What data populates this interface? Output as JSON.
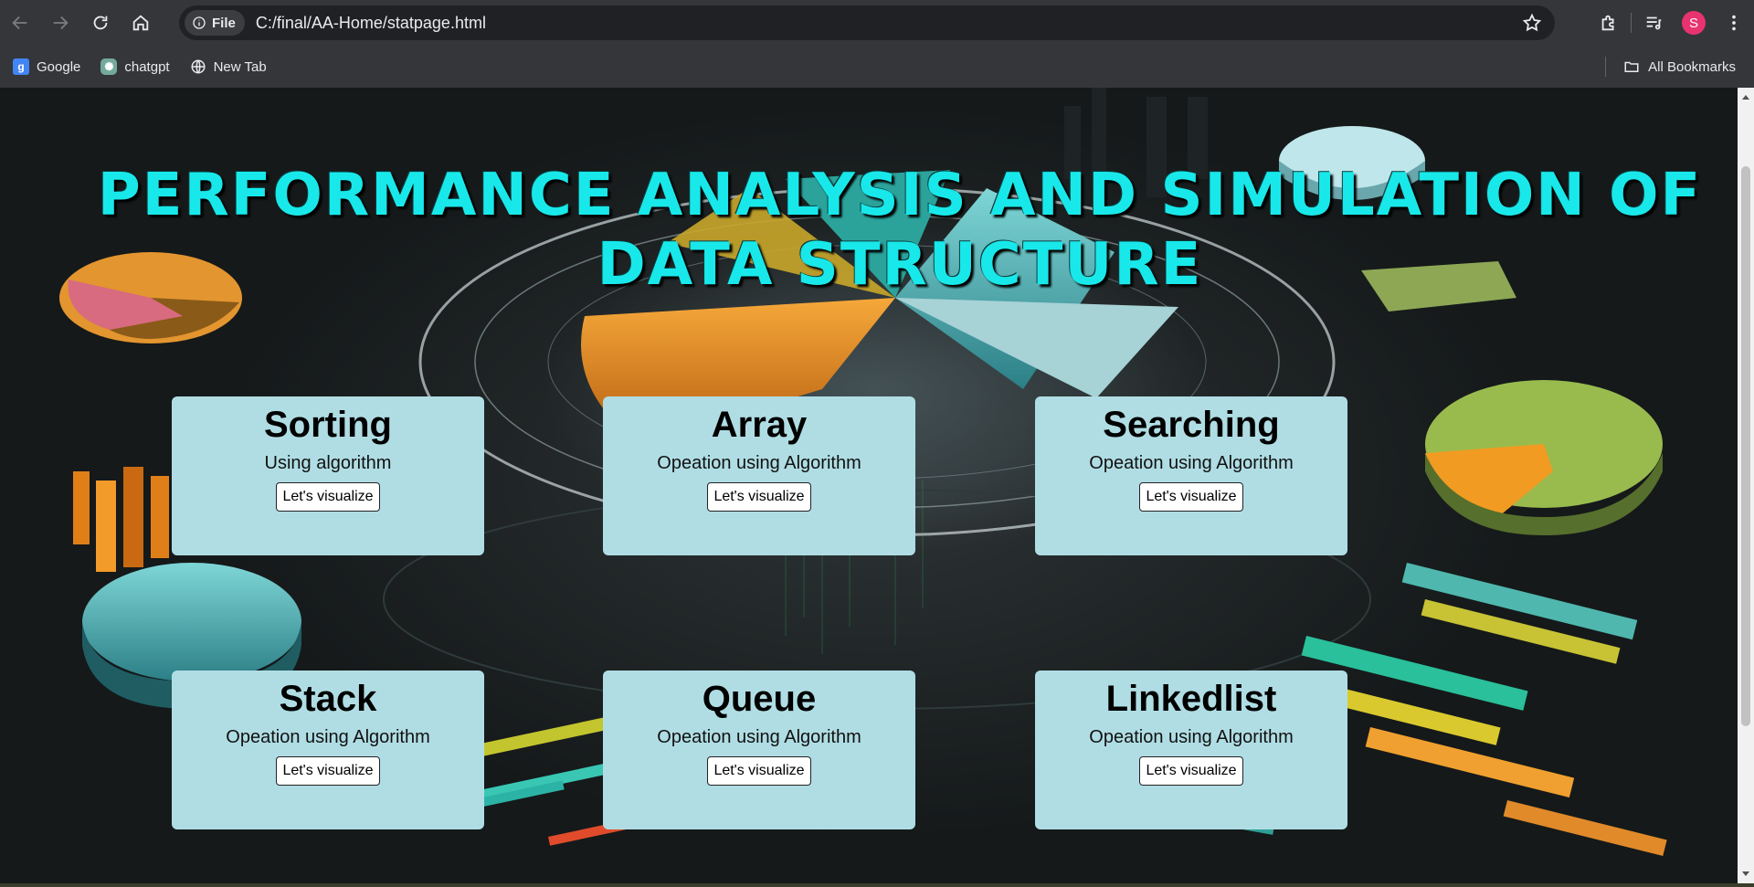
{
  "browser": {
    "file_chip_label": "File",
    "url": "C:/final/AA-Home/statpage.html",
    "profile_initial": "S",
    "bookmarks": [
      {
        "label": "Google",
        "icon": "google-icon"
      },
      {
        "label": "chatgpt",
        "icon": "chatgpt-icon"
      },
      {
        "label": "New Tab",
        "icon": "globe-icon"
      }
    ],
    "all_bookmarks_label": "All Bookmarks"
  },
  "page": {
    "title": "PERFORMANCE ANALYSIS AND SIMULATION OF DATA STRUCTURE",
    "cards": [
      {
        "title": "Sorting",
        "subtitle": "Using algorithm",
        "button": "Let's visualize"
      },
      {
        "title": "Array",
        "subtitle": "Opeation using Algorithm",
        "button": "Let's visualize"
      },
      {
        "title": "Searching",
        "subtitle": "Opeation using Algorithm",
        "button": "Let's visualize"
      },
      {
        "title": "Stack",
        "subtitle": "Opeation using Algorithm",
        "button": "Let's visualize"
      },
      {
        "title": "Queue",
        "subtitle": "Opeation using Algorithm",
        "button": "Let's visualize"
      },
      {
        "title": "Linkedlist",
        "subtitle": "Opeation using Algorithm",
        "button": "Let's visualize"
      }
    ]
  },
  "colors": {
    "title": "#19e8ea",
    "card_background": "#b0dde4",
    "chrome_background": "#35363a",
    "avatar": "#e8336f"
  }
}
